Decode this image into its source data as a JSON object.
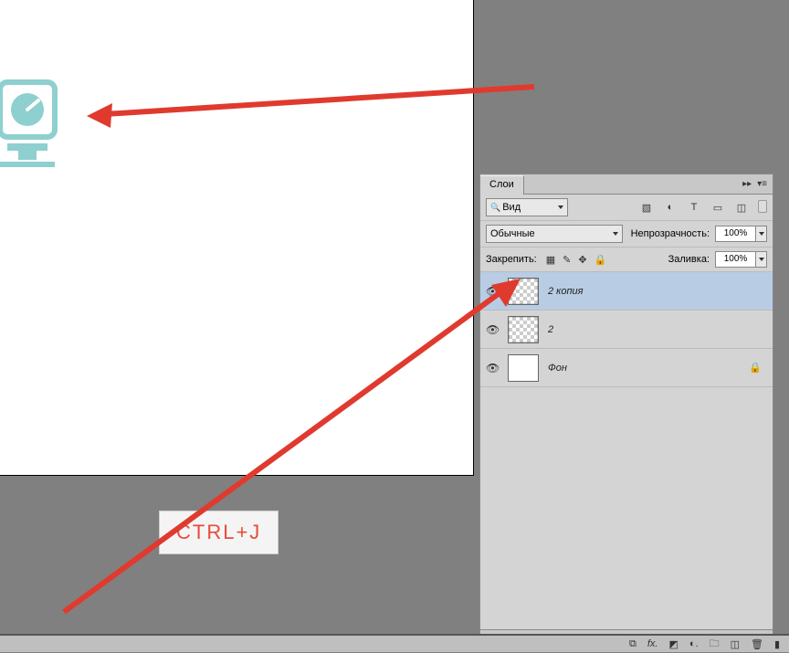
{
  "panel": {
    "title": "Слои",
    "filter_mode": "Вид",
    "filter_icons": [
      "image-icon",
      "adjustment-icon",
      "type-icon",
      "shape-icon",
      "smartobject-icon"
    ],
    "blend_mode": "Обычные",
    "opacity_label": "Непрозрачность:",
    "opacity_value": "100%",
    "lock_label": "Закрепить:",
    "fill_label": "Заливка:",
    "fill_value": "100%"
  },
  "layers": [
    {
      "name": "2 копия",
      "transparent": true,
      "selected": true,
      "locked": false
    },
    {
      "name": "2",
      "transparent": true,
      "selected": false,
      "locked": false
    },
    {
      "name": "Фон",
      "transparent": false,
      "selected": false,
      "locked": true
    }
  ],
  "annotation": {
    "text": "CTRL+J"
  },
  "colors": {
    "accent_arrow": "#e03a2f",
    "icon_teal": "#8ecfcf"
  }
}
